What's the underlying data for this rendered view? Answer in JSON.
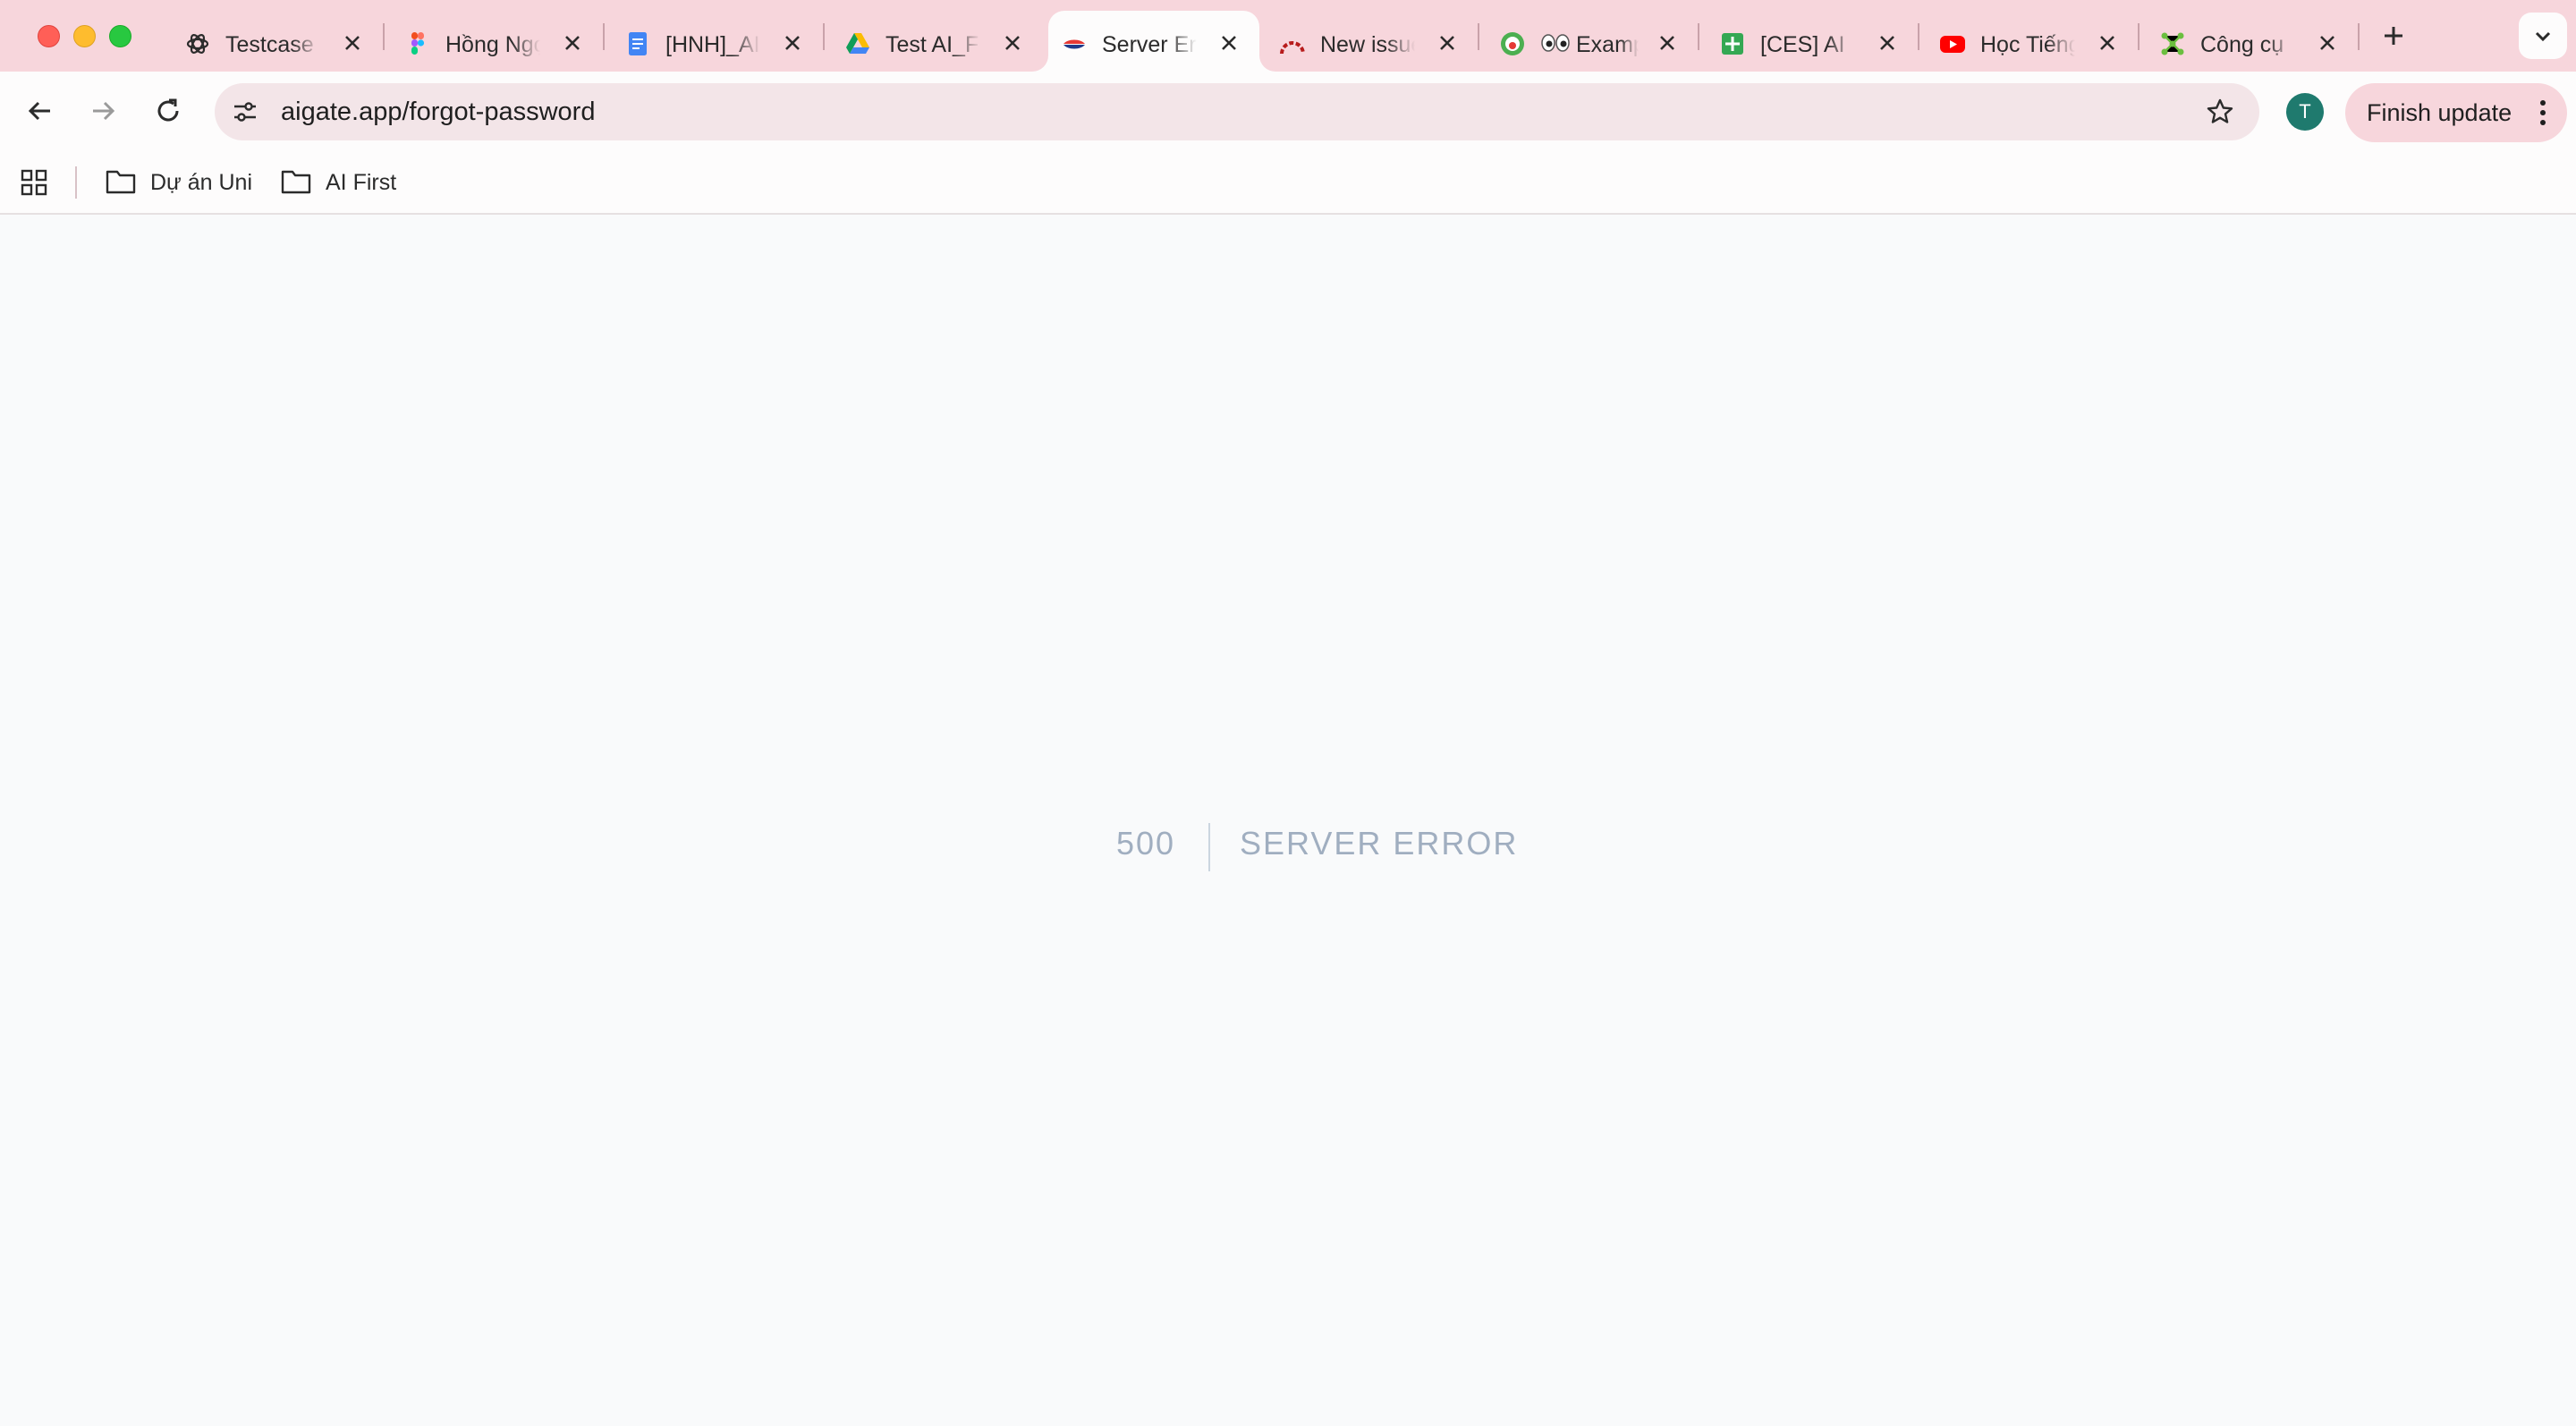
{
  "browser": {
    "tabs": [
      {
        "title": "Testcase",
        "icon": "openai-icon"
      },
      {
        "title": "Hồng Ngọc",
        "icon": "figma-icon"
      },
      {
        "title": "[HNH]_AI",
        "icon": "google-docs-icon"
      },
      {
        "title": "Test AI_F",
        "icon": "google-drive-icon"
      },
      {
        "title": "Server Error",
        "icon": "aigate-icon",
        "active": true
      },
      {
        "title": "New issue",
        "icon": "redmine-icon"
      },
      {
        "title": "Example",
        "icon": "eyes-emoji-icon"
      },
      {
        "title": "[CES] AI",
        "icon": "google-sheets-icon"
      },
      {
        "title": "Học Tiếng",
        "icon": "youtube-icon"
      },
      {
        "title": "Công cụ",
        "icon": "network-icon"
      }
    ],
    "address": {
      "url": "aigate.app/forgot-password"
    },
    "profile": {
      "initial": "T",
      "color": "#1f7a6e"
    },
    "update_button": {
      "label": "Finish update"
    },
    "bookmarks": [
      {
        "label": "Dự án Uni"
      },
      {
        "label": "AI First"
      }
    ]
  },
  "page": {
    "code": "500",
    "message": "SERVER ERROR"
  },
  "colors": {
    "tabstrip": "#f7d6dc",
    "toolbar": "#fdfcfc",
    "omnibox": "#f3e5e8",
    "page_background": "#f9fafb",
    "error_text": "#a0aec0"
  }
}
